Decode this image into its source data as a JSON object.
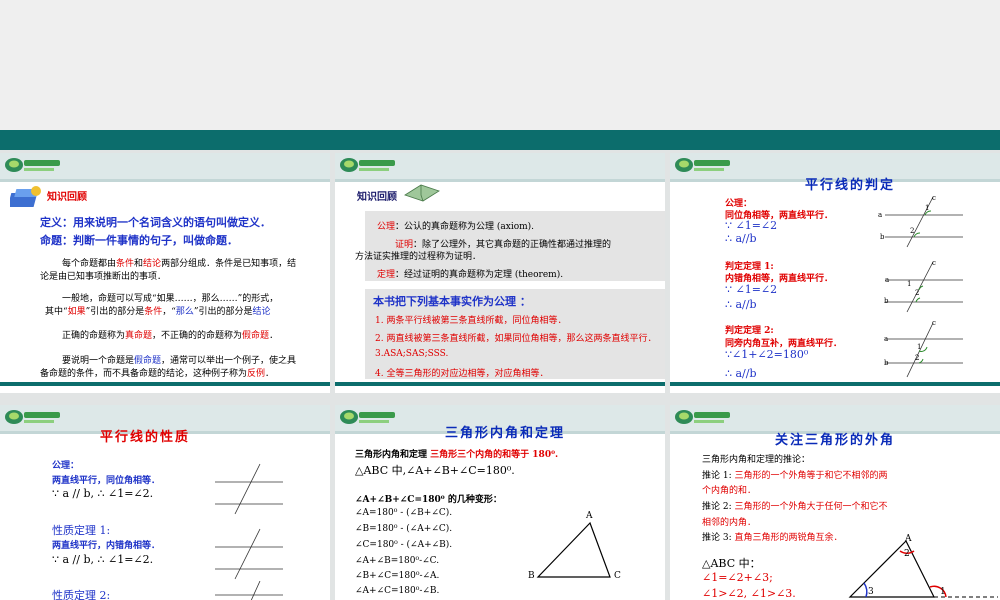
{
  "slides": [
    {
      "title": "知识回顾",
      "definition": "定义：用来说明一个名词含义的语句叫做定义．",
      "proposition": "命题：判断一件事情的句子，叫做命题．",
      "para1a": "每个命题都由",
      "para1b": "条件",
      "para1c": "和",
      "para1d": "结论",
      "para1e": "两部分组成．条件是已知事项，结",
      "para1f": "论是由已知事项推断出的事项．",
      "para2a": "一般地，命题可以写成“如果……，那么……”的形式，",
      "para2b": "其中“",
      "para2c": "如果",
      "para2d": "”引出的部分是",
      "para2e": "条件",
      "para2f": "，“",
      "para2g": "那么",
      "para2h": "”引出的部分是",
      "para2i": "结论",
      "para3a": "正确的命题称为",
      "para3b": "真命题",
      "para3c": "，不正确的的命题称为",
      "para3d": "假命题",
      "para3e": "．",
      "para4a": "要说明一个命题是",
      "para4b": "假命题",
      "para4c": "，通常可以举出一个例子，使之具",
      "para4d": "备命题的条件，而不具备命题的结论，这种例子称为",
      "para4e": "反例",
      "para4f": "．"
    },
    {
      "title": "知识回顾",
      "axiom_label": "公理",
      "axiom_text": "：公认的真命题称为公理 (axiom).",
      "proof_label": "证明",
      "proof_text": "：除了公理外，其它真命题的正确性都通过推理的",
      "proof_text2": "方法证实推理的过程称为证明．",
      "theorem_label": "定理",
      "theorem_text": "：经过证明的真命题称为定理 (theorem).",
      "basic": "本书把下列基本事实作为公理 ：",
      "items": [
        "1. 两条平行线被第三条直线所截，同位角相等．",
        "2. 两直线被第三条直线所截，如果同位角相等，那么这两条直线平行．",
        "3.ASA;SAS;SSS.",
        "4. 全等三角形的对应边相等，对应角相等．"
      ]
    },
    {
      "title": "平行线的判定",
      "g1_head": "公理：",
      "g1_line": "同位角相等，两直线平行．",
      "g1_because": "∵ ∠1=∠2",
      "g1_therefore": "∴ a//b",
      "g2_head": "判定定理 1:",
      "g2_line": "内错角相等，两直线平行．",
      "g2_because": "∵ ∠1=∠2",
      "g2_therefore": "∴ a//b",
      "g3_head": "判定定理 2:",
      "g3_line": "同旁内角互补，两直线平行．",
      "g3_because": "∵∠1+∠2=180⁰",
      "g3_therefore": "∴ a//b",
      "lbl_a": "a",
      "lbl_b": "b",
      "lbl_c": "c",
      "lbl_1": "1",
      "lbl_2": "2"
    },
    {
      "title": "平行线的性质",
      "g1_head": "公理：",
      "g1_line": "两直线平行，同位角相等．",
      "g1_math": "∵ a // b, ∴ ∠1=∠2.",
      "g2_head": "性质定理 1:",
      "g2_line": "两直线平行，内错角相等．",
      "g2_math": "∵ a // b, ∴ ∠1=∠2.",
      "g3_head": "性质定理 2:"
    },
    {
      "title": "三角形内角和定理",
      "line1_a": "三角形内角和定理",
      "line1_b": "三角形三个内角的和等于 180⁰.",
      "line2": "△ABC 中,∠A+∠B+∠C=180⁰.",
      "line3": "∠A+∠B+∠C=180⁰ 的几种变形：",
      "forms": [
        "∠A=180⁰ - (∠B+∠C).",
        "∠B=180⁰ - (∠A+∠C).",
        "∠C=180⁰ - (∠A+∠B).",
        "∠A+∠B=180⁰-∠C.",
        "∠B+∠C=180⁰-∠A.",
        "∠A+∠C=180⁰-∠B."
      ],
      "tri_a": "A",
      "tri_b": "B",
      "tri_c": "C"
    },
    {
      "title": "关注三角形的外角",
      "l1": "三角形内角和定理的推论：",
      "c1_label": "推论 1:",
      "c1_text": "三角形的一个外角等于和它不相邻的两",
      "c1_text2": "个内角的和．",
      "c2_label": "推论 2:",
      "c2_text": "三角形的一个外角大于任何一个和它不",
      "c2_text2": "相邻的内角．",
      "c3_label": "推论 3:",
      "c3_text": "直角三角形的两锐角互余．",
      "abc": "△ABC 中：",
      "eq1": "∠1=∠2+∠3;",
      "eq2": "∠1>∠2, ∠1>∠3.",
      "fig_a": "A",
      "fig_1": "1",
      "fig_2": "2",
      "fig_3": "3"
    }
  ]
}
